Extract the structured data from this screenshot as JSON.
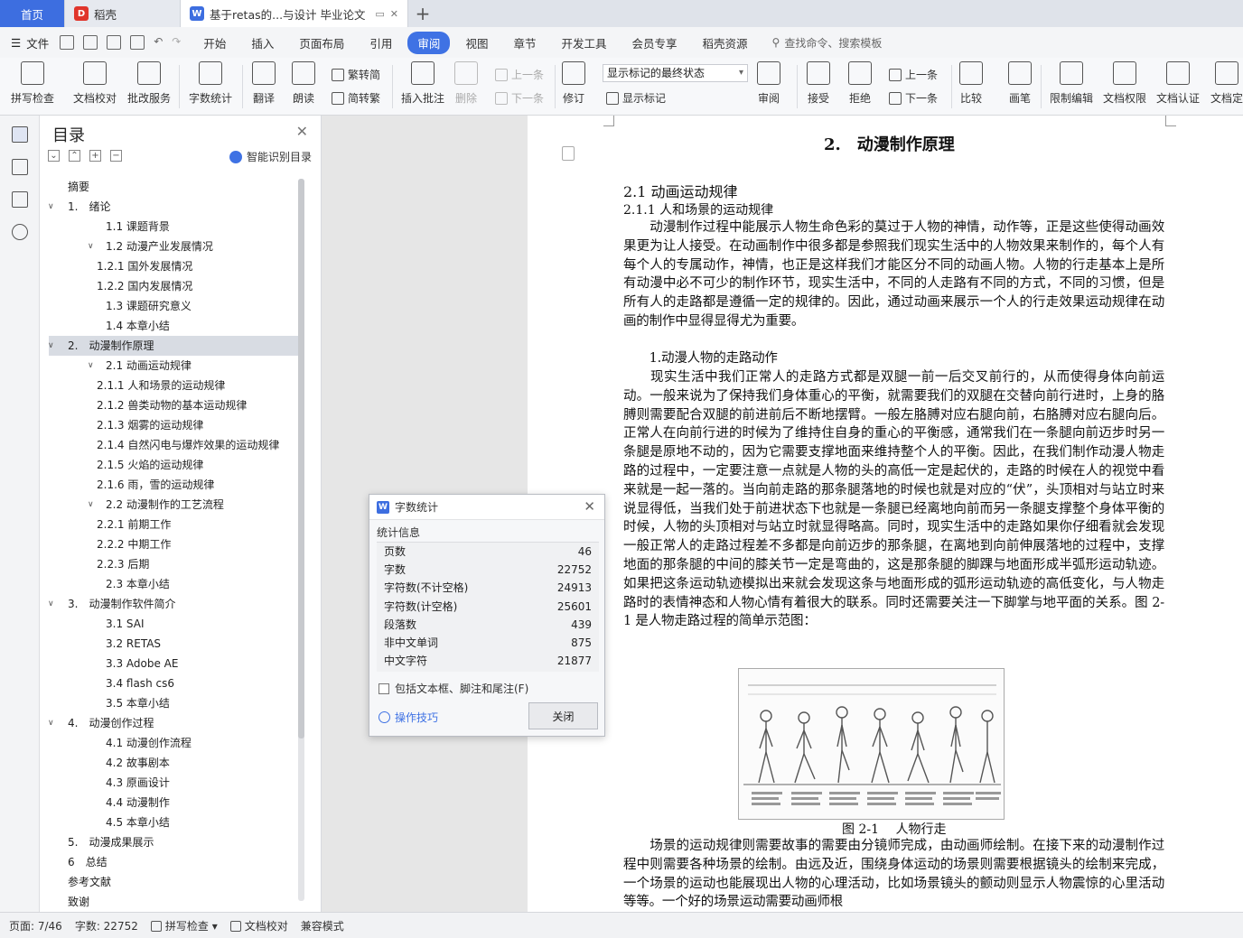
{
  "tabs": {
    "home": "首页",
    "daoke": "稻壳",
    "doc": "基于retas的...与设计 毕业论文",
    "add": "+"
  },
  "menu": {
    "file": "文件",
    "tabs": [
      "开始",
      "插入",
      "页面布局",
      "引用",
      "审阅",
      "视图",
      "章节",
      "开发工具",
      "会员专享",
      "稻壳资源"
    ],
    "active": "审阅",
    "search": "查找命令、搜索模板"
  },
  "ribbon": {
    "spell": "拼写检查",
    "proof": "文档校对",
    "batch": "批改服务",
    "wordcount": "字数统计",
    "translate": "翻译",
    "read": "朗读",
    "trad": "繁转简",
    "simp": "简转繁",
    "insert_comment": "插入批注",
    "delete": "删除",
    "prev": "上一条",
    "next": "下一条",
    "revise": "修订",
    "markup_state": "显示标记的最终状态",
    "show_markup": "显示标记",
    "review": "审阅",
    "accept": "接受",
    "reject": "拒绝",
    "prev2": "上一条",
    "next2": "下一条",
    "compare": "比较",
    "pen": "画笔",
    "restrict": "限制编辑",
    "rights": "文档权限",
    "cert": "文档认证",
    "verify": "文档定"
  },
  "toc": {
    "title": "目录",
    "smart": "智能识别目录",
    "items": [
      {
        "text": "摘要",
        "indent": 0,
        "caret": false
      },
      {
        "text": "1.　绪论",
        "indent": 0,
        "caret": true
      },
      {
        "text": "1.1  课题背景",
        "indent": 1,
        "caret": false
      },
      {
        "text": "1.2  动漫产业发展情况",
        "indent": 1,
        "caret": true
      },
      {
        "text": "1.2.1  国外发展情况",
        "indent": 2,
        "caret": false
      },
      {
        "text": "1.2.2  国内发展情况",
        "indent": 2,
        "caret": false
      },
      {
        "text": "1.3  课题研究意义",
        "indent": 1,
        "caret": false
      },
      {
        "text": "1.4  本章小结",
        "indent": 1,
        "caret": false
      },
      {
        "text": "2.　动漫制作原理",
        "indent": 0,
        "caret": true,
        "selected": true
      },
      {
        "text": "2.1 动画运动规律",
        "indent": 1,
        "caret": true
      },
      {
        "text": "2.1.1 人和场景的运动规律",
        "indent": 2,
        "caret": false
      },
      {
        "text": "2.1.2 兽类动物的基本运动规律",
        "indent": 2,
        "caret": false
      },
      {
        "text": "2.1.3 烟雾的运动规律",
        "indent": 2,
        "caret": false
      },
      {
        "text": "2.1.4 自然闪电与爆炸效果的运动规律",
        "indent": 2,
        "caret": false
      },
      {
        "text": "2.1.5 火焰的运动规律",
        "indent": 2,
        "caret": false
      },
      {
        "text": "2.1.6  雨，雪的运动规律",
        "indent": 2,
        "caret": false
      },
      {
        "text": "2.2 动漫制作的工艺流程",
        "indent": 1,
        "caret": true
      },
      {
        "text": "2.2.1  前期工作",
        "indent": 2,
        "caret": false
      },
      {
        "text": "2.2.2  中期工作",
        "indent": 2,
        "caret": false
      },
      {
        "text": "2.2.3  后期",
        "indent": 2,
        "caret": false
      },
      {
        "text": "2.3  本章小结",
        "indent": 1,
        "caret": false
      },
      {
        "text": "3.　动漫制作软件简介",
        "indent": 0,
        "caret": true
      },
      {
        "text": "3.1 SAI",
        "indent": 1,
        "caret": false
      },
      {
        "text": "3.2 RETAS",
        "indent": 1,
        "caret": false
      },
      {
        "text": "3.3 Adobe AE",
        "indent": 1,
        "caret": false
      },
      {
        "text": "3.4 flash cs6",
        "indent": 1,
        "caret": false
      },
      {
        "text": "3.5  本章小结",
        "indent": 1,
        "caret": false
      },
      {
        "text": "4.　动漫创作过程",
        "indent": 0,
        "caret": true
      },
      {
        "text": "4.1  动漫创作流程",
        "indent": 1,
        "caret": false
      },
      {
        "text": "4.2  故事剧本",
        "indent": 1,
        "caret": false
      },
      {
        "text": "4.3  原画设计",
        "indent": 1,
        "caret": false
      },
      {
        "text": "4.4  动漫制作",
        "indent": 1,
        "caret": false
      },
      {
        "text": "4.5  本章小结",
        "indent": 1,
        "caret": false
      },
      {
        "text": "5.　动漫成果展示",
        "indent": 0,
        "caret": false
      },
      {
        "text": "6　总结",
        "indent": 0,
        "caret": false
      },
      {
        "text": "参考文献",
        "indent": 0,
        "caret": false
      },
      {
        "text": "致谢",
        "indent": 0,
        "caret": false
      }
    ]
  },
  "document": {
    "chapter": "2.　动漫制作原理",
    "h2": "2.1 动画运动规律",
    "h3": "2.1.1 人和场景的运动规律",
    "p1": "　　动漫制作过程中能展示人物生命色彩的莫过于人物的神情，动作等，正是这些使得动画效果更为让人接受。在动画制作中很多都是参照我们现实生活中的人物效果来制作的，每个人有每个人的专属动作，神情，也正是这样我们才能区分不同的动画人物。人物的行走基本上是所有动漫中必不可少的制作环节，现实生活中，不同的人走路有不同的方式，不同的习惯，但是所有人的走路都是遵循一定的规律的。因此，通过动画来展示一个人的行走效果运动规律在动画的制作中显得显得尤为重要。",
    "p2": "　　1.动漫人物的走路动作",
    "p3": "　　现实生活中我们正常人的走路方式都是双腿一前一后交叉前行的，从而使得身体向前运动。一般来说为了保持我们身体重心的平衡，就需要我们的双腿在交替向前行进时，上身的胳膊则需要配合双腿的前进前后不断地摆臂。一般左胳膊对应右腿向前，右胳膊对应右腿向后。正常人在向前行进的时候为了维持住自身的重心的平衡感，通常我们在一条腿向前迈步时另一条腿是原地不动的，因为它需要支撑地面来维持整个人的平衡。因此，在我们制作动漫人物走路的过程中，一定要注意一点就是人物的头的高低一定是起伏的，走路的时候在人的视觉中看来就是一起一落的。当向前走路的那条腿落地的时候也就是对应的“伏”，头顶相对与站立时来说显得低，当我们处于前进状态下也就是一条腿已经离地向前而另一条腿支撑整个身体平衡的时候，人物的头顶相对与站立时就显得略高。同时，现实生活中的走路如果你仔细看就会发现一般正常人的走路过程差不多都是向前迈步的那条腿，在离地到向前伸展落地的过程中，支撑地面的那条腿的中间的膝关节一定是弯曲的，这是那条腿的脚踝与地面形成半弧形运动轨迹。如果把这条运动轨迹模拟出来就会发现这条与地面形成的弧形运动轨迹的高低变化，与人物走路时的表情神态和人物心情有着很大的联系。同时还需要关注一下脚掌与地平面的关系。图 2-1 是人物走路过程的简单示范图：",
    "fig_caption": "图 2-1　 人物行走",
    "p4": "　　场景的运动规律则需要故事的需要由分镜师完成，由动画师绘制。在接下来的动漫制作过程中则需要各种场景的绘制。由远及近，围绕身体运动的场景则需要根据镜头的绘制来完成，一个场景的运动也能展现出人物的心理活动，比如场景镜头的颤动则显示人物震惊的心里活动等等。一个好的场景运动需要动画师根"
  },
  "dialog": {
    "title": "字数统计",
    "section": "统计信息",
    "rows": [
      {
        "label": "页数",
        "value": "46"
      },
      {
        "label": "字数",
        "value": "22752"
      },
      {
        "label": "字符数(不计空格)",
        "value": "24913"
      },
      {
        "label": "字符数(计空格)",
        "value": "25601"
      },
      {
        "label": "段落数",
        "value": "439"
      },
      {
        "label": "非中文单词",
        "value": "875"
      },
      {
        "label": "中文字符",
        "value": "21877"
      }
    ],
    "checkbox": "包括文本框、脚注和尾注(F)",
    "tips": "操作技巧",
    "close": "关闭"
  },
  "status": {
    "page": "页面: 7/46",
    "words": "字数: 22752",
    "spell": "拼写检查",
    "proof": "文档校对",
    "compat": "兼容模式"
  },
  "colors": {
    "accent": "#3f72e4",
    "home_tab": "#3d6ee0",
    "daoke_red": "#e0352b"
  }
}
